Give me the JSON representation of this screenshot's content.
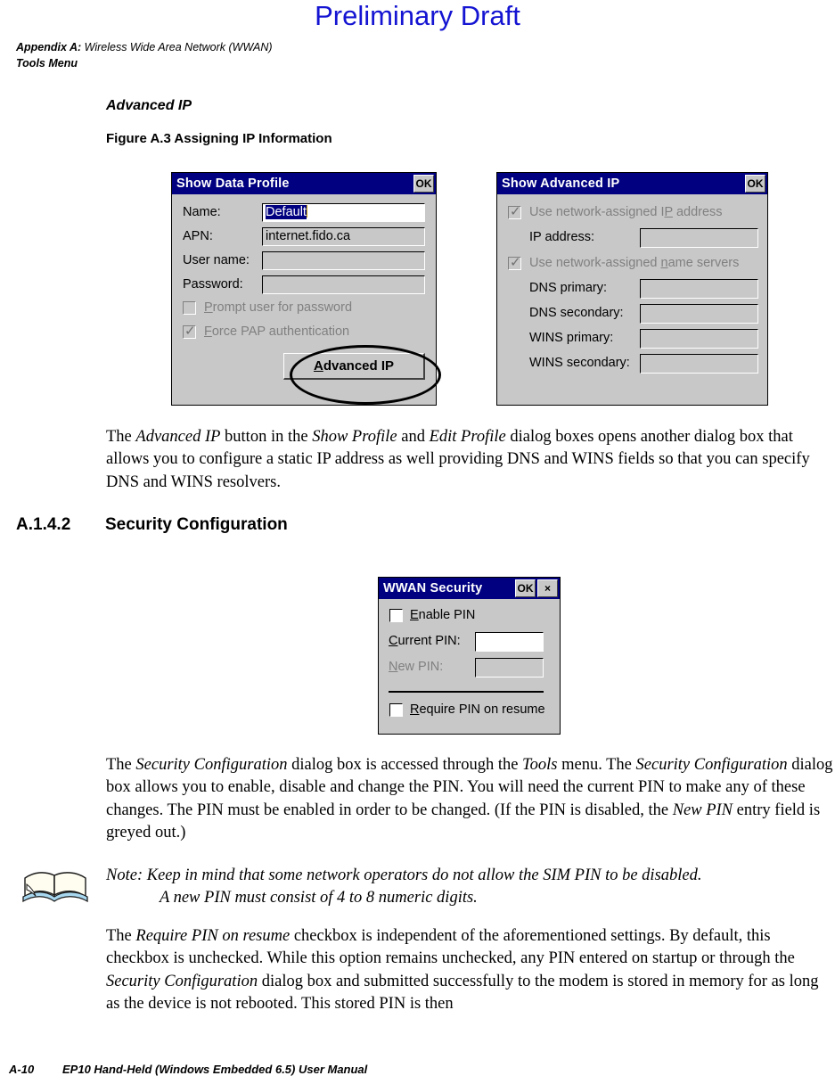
{
  "page": {
    "watermark": "Preliminary Draft",
    "header_appendix": "Appendix A:",
    "header_title": "Wireless Wide Area Network (WWAN)",
    "header_subtitle": "Tools Menu",
    "footer_page": "A-10",
    "footer_title": "EP10 Hand-Held (Windows Embedded 6.5) User Manual"
  },
  "sections": {
    "advanced_ip_heading": "Advanced IP",
    "figure_caption": "Figure A.3  Assigning IP Information",
    "security_number": "A.1.4.2",
    "security_heading": "Security Configuration"
  },
  "paragraphs": {
    "advanced_ip": {
      "t1": "The ",
      "i1": "Advanced IP",
      "t2": " button in the ",
      "i2": "Show Profile",
      "t3": " and ",
      "i3": "Edit Profile",
      "t4": " dialog boxes opens another dialog box that allows you to configure a static IP address as well providing DNS and WINS fields so that you can specify DNS and WINS resolvers."
    },
    "security": {
      "t1": "The ",
      "i1": "Security Configuration",
      "t2": " dialog box is accessed through the ",
      "i2": "Tools",
      "t3": " menu. The ",
      "i3": "Security Configuration",
      "t4": " dialog box allows you to enable, disable and change the PIN. You will need the current PIN to make any of these changes. The PIN must be enabled in order to be changed. (If the PIN is disabled, the ",
      "i4": "New PIN",
      "t5": " entry field is greyed out.)"
    },
    "require_pin": {
      "t1": "The ",
      "i1": "Require PIN on resume",
      "t2": " checkbox is independent of the aforementioned settings. By default, this checkbox is unchecked. While this option remains unchecked, any PIN entered on startup or through the ",
      "i2": "Security Configuration",
      "t3": " dialog box and submitted successfully to the modem is stored in memory for as long as the device is not rebooted. This stored PIN is then"
    }
  },
  "note": {
    "line1": "Note: Keep in mind that some network operators do not allow the SIM PIN to be disabled.",
    "line2": "A new PIN must consist of 4 to 8 numeric digits."
  },
  "dialogs": {
    "show_data_profile": {
      "title": "Show Data Profile",
      "ok_label": "OK",
      "fields": [
        {
          "label": "Name:",
          "value": "Default"
        },
        {
          "label": "APN:",
          "value": "internet.fido.ca"
        },
        {
          "label": "User name:",
          "value": ""
        },
        {
          "label": "Password:",
          "value": ""
        }
      ],
      "checkboxes": [
        {
          "label_pre": "P",
          "label_post": "rompt user for password",
          "checked": false,
          "disabled": true
        },
        {
          "label_pre": "F",
          "label_post": "orce PAP authentication",
          "checked": true,
          "disabled": true
        }
      ],
      "button": {
        "pre": "A",
        "post": "dvanced IP"
      }
    },
    "show_advanced_ip": {
      "title": "Show Advanced IP",
      "ok_label": "OK",
      "checkbox_ip": {
        "pre": "Use network-assigned I",
        "mid": "P",
        "post": " address",
        "checked": true,
        "disabled": true
      },
      "checkbox_dns": {
        "pre": "Use network-assigned ",
        "mid": "n",
        "post": "ame servers",
        "checked": true,
        "disabled": true
      },
      "fields": [
        {
          "label": "IP address:",
          "value": ""
        },
        {
          "label": "DNS primary:",
          "value": ""
        },
        {
          "label": "DNS secondary:",
          "value": ""
        },
        {
          "label": "WINS primary:",
          "value": ""
        },
        {
          "label": "WINS secondary:",
          "value": ""
        }
      ]
    },
    "wwan_security": {
      "title": "WWAN Security",
      "ok_label": "OK",
      "close_label": "×",
      "enable_pin": {
        "pre": "E",
        "post": "nable PIN",
        "checked": false
      },
      "current_pin": {
        "pre": "C",
        "post": "urrent PIN:",
        "value": ""
      },
      "new_pin": {
        "pre": "N",
        "post": "ew PIN:",
        "value": "",
        "disabled": true
      },
      "require_pin": {
        "pre": "R",
        "post": "equire PIN on resume",
        "checked": false
      }
    }
  },
  "colors": {
    "watermark": "#1414d2",
    "titlebar": "#000080",
    "dialog_face": "#c8c8c8"
  }
}
